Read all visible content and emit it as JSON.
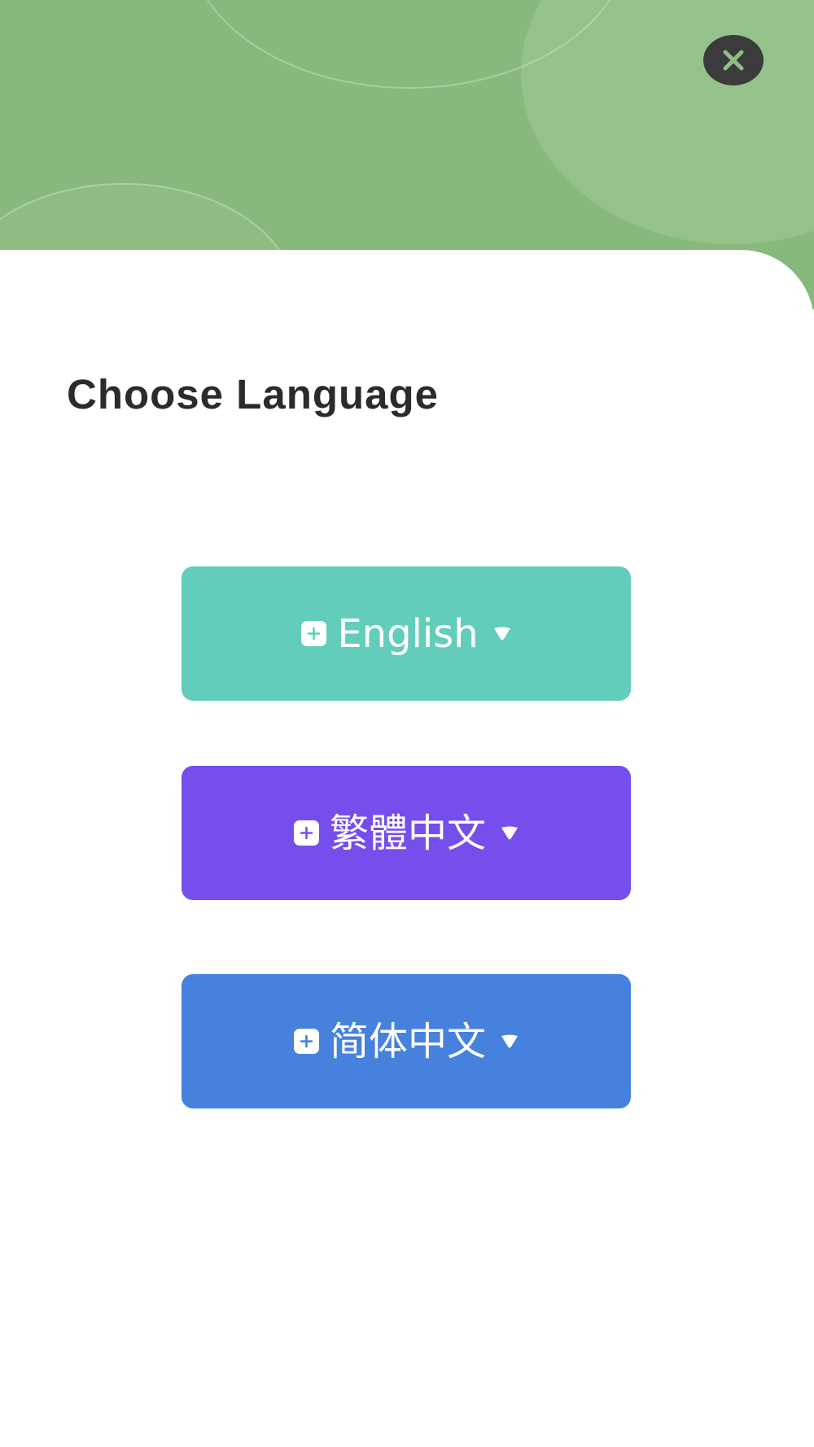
{
  "header": {
    "background_color": "#87b97c",
    "close_icon": "close-icon"
  },
  "dialog": {
    "title": "Choose Language"
  },
  "languages": [
    {
      "label": "English",
      "color": "#63cdbb",
      "icon": "plus-square-icon",
      "caret": "caret-down-icon"
    },
    {
      "label": "繁體中文",
      "color": "#764eeb",
      "icon": "plus-square-icon",
      "caret": "caret-down-icon"
    },
    {
      "label": "简体中文",
      "color": "#4781de",
      "icon": "plus-square-icon",
      "caret": "caret-down-icon"
    }
  ]
}
